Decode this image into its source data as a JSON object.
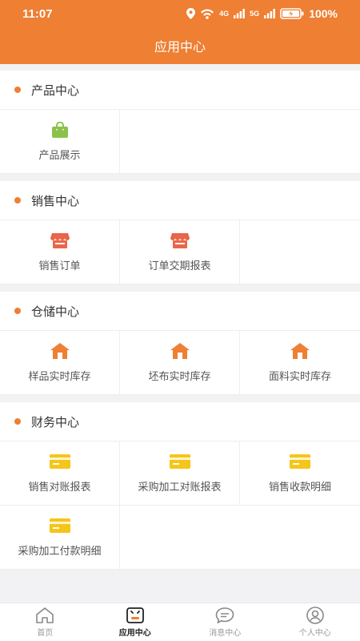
{
  "status_bar": {
    "time": "11:07",
    "battery": "100%",
    "net_a": "4G",
    "net_b": "5G"
  },
  "header": {
    "title": "应用中心"
  },
  "sections": [
    {
      "title": "产品中心",
      "items": [
        {
          "label": "产品展示",
          "icon": "bag-icon"
        }
      ]
    },
    {
      "title": "销售中心",
      "items": [
        {
          "label": "销售订单",
          "icon": "shop-icon"
        },
        {
          "label": "订单交期报表",
          "icon": "shop-icon"
        }
      ]
    },
    {
      "title": "仓储中心",
      "items": [
        {
          "label": "样品实时库存",
          "icon": "warehouse-icon"
        },
        {
          "label": "坯布实时库存",
          "icon": "warehouse-icon"
        },
        {
          "label": "面料实时库存",
          "icon": "warehouse-icon"
        }
      ]
    },
    {
      "title": "财务中心",
      "items": [
        {
          "label": "销售对账报表",
          "icon": "card-icon"
        },
        {
          "label": "采购加工对账报表",
          "icon": "card-icon"
        },
        {
          "label": "销售收款明细",
          "icon": "card-icon"
        },
        {
          "label": "采购加工付款明细",
          "icon": "card-icon"
        }
      ]
    }
  ],
  "tabs": [
    {
      "label": "首页",
      "icon": "home-icon"
    },
    {
      "label": "应用中心",
      "icon": "apps-icon"
    },
    {
      "label": "消息中心",
      "icon": "message-icon"
    },
    {
      "label": "个人中心",
      "icon": "profile-icon"
    }
  ],
  "colors": {
    "accent": "#ee7f33",
    "bag": "#8bc34a",
    "shop": "#e8664a",
    "warehouse": "#ee7f33",
    "card": "#f5c518"
  }
}
